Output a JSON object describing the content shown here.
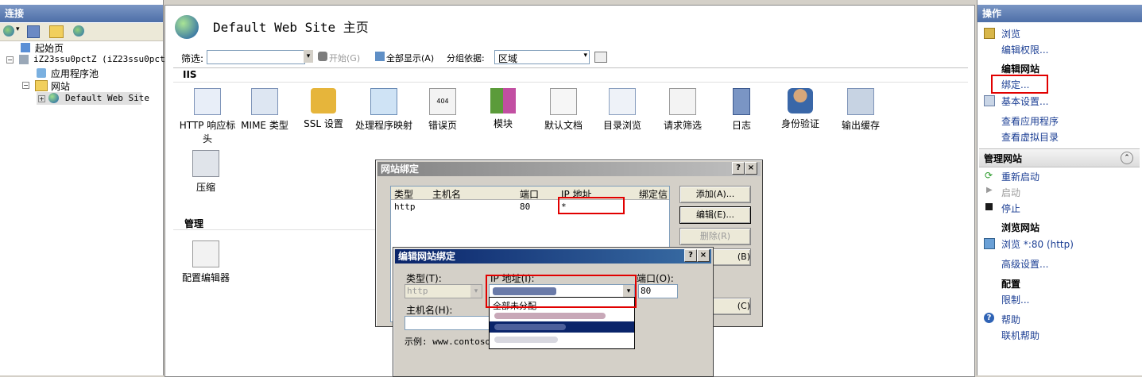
{
  "connections": {
    "title": "连接",
    "tree": {
      "start_page": "起始页",
      "server": "iZ23ssu0pctZ (iZ23ssu0pctZ",
      "app_pools": "应用程序池",
      "sites": "网站",
      "default_site": "Default Web Site"
    }
  },
  "main": {
    "title": "Default Web Site 主页",
    "filter_label": "筛选:",
    "start_label": "开始(G)",
    "show_all_label": "全部显示(A)",
    "group_by_label": "分组依据:",
    "group_by_value": "区域",
    "section_iis": "IIS",
    "section_manage": "管理",
    "features": {
      "http_headers": "HTTP 响应标头",
      "mime": "MIME 类型",
      "ssl": "SSL 设置",
      "handlers": "处理程序映射",
      "errors": "错误页",
      "modules": "模块",
      "default_doc": "默认文档",
      "dir_browse": "目录浏览",
      "request_filter": "请求筛选",
      "logging": "日志",
      "auth": "身份验证",
      "output_cache": "输出缓存",
      "compression": "压缩",
      "config_editor": "配置编辑器"
    }
  },
  "actions": {
    "title": "操作",
    "browse": "浏览",
    "edit_perms": "编辑权限...",
    "edit_site_header": "编辑网站",
    "bindings": "绑定...",
    "basic_settings": "基本设置...",
    "view_apps": "查看应用程序",
    "view_vdirs": "查看虚拟目录",
    "manage_site_header": "管理网站",
    "restart": "重新启动",
    "start": "启动",
    "stop": "停止",
    "browse_site_header": "浏览网站",
    "browse_80": "浏览 *:80 (http)",
    "advanced": "高级设置...",
    "config_header": "配置",
    "limits": "限制...",
    "help": "帮助",
    "online_help": "联机帮助"
  },
  "site_bindings_dialog": {
    "title": "网站绑定",
    "columns": [
      "类型",
      "主机名",
      "端口",
      "IP 地址",
      "绑定信"
    ],
    "row": {
      "type": "http",
      "host": "",
      "port": "80",
      "ip": "*"
    },
    "add_btn": "添加(A)...",
    "edit_btn": "编辑(E)...",
    "remove_btn": "删除(R)",
    "browse_btn": "(B)",
    "close_btn": "(C)"
  },
  "edit_binding_dialog": {
    "title": "编辑网站绑定",
    "type_label": "类型(T):",
    "type_value": "http",
    "ip_label": "IP 地址(I):",
    "port_label": "端口(O):",
    "port_value": "80",
    "host_label": "主机名(H):",
    "example": "示例: www.contoso.",
    "ip_option_unassigned": "全部未分配"
  },
  "colors": {
    "header_blue": "#4e6fa8",
    "dialog_title": "#0a246a",
    "highlight": "#e10000",
    "selection": "#0a246a"
  }
}
